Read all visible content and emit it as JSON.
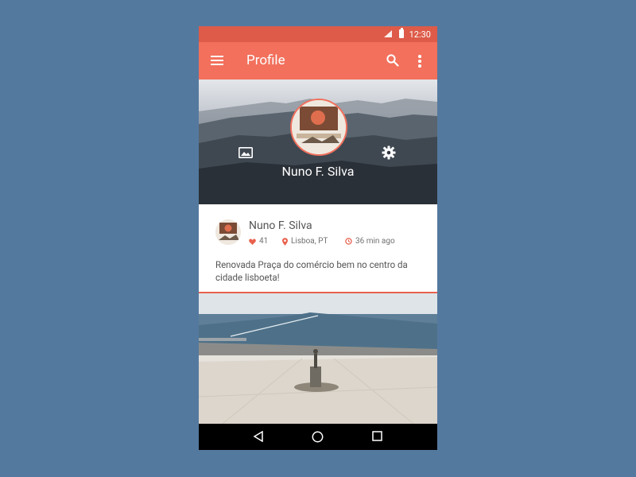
{
  "status_bar": {
    "time": "12:30"
  },
  "app_bar": {
    "title": "Profile"
  },
  "profile": {
    "name": "Nuno F. Silva"
  },
  "post": {
    "author": "Nuno F. Silva",
    "likes": "41",
    "location": "Lisboa, PT",
    "time_ago": "36 min ago",
    "text": "Renovada Praça do comércio bem no centro da cidade lisboeta!"
  },
  "icons": {
    "menu": "menu-icon",
    "search": "search-icon",
    "more": "more-vert-icon",
    "image": "image-icon",
    "settings": "gear-icon",
    "like": "heart-icon",
    "location": "location-pin-icon",
    "time": "clock-icon",
    "back": "back-triangle-icon",
    "home": "home-circle-icon",
    "recents": "recents-square-icon"
  },
  "colors": {
    "background": "#54799f",
    "status_bar": "#dd5b48",
    "app_bar": "#f2705c",
    "accent": "#e9624e"
  }
}
